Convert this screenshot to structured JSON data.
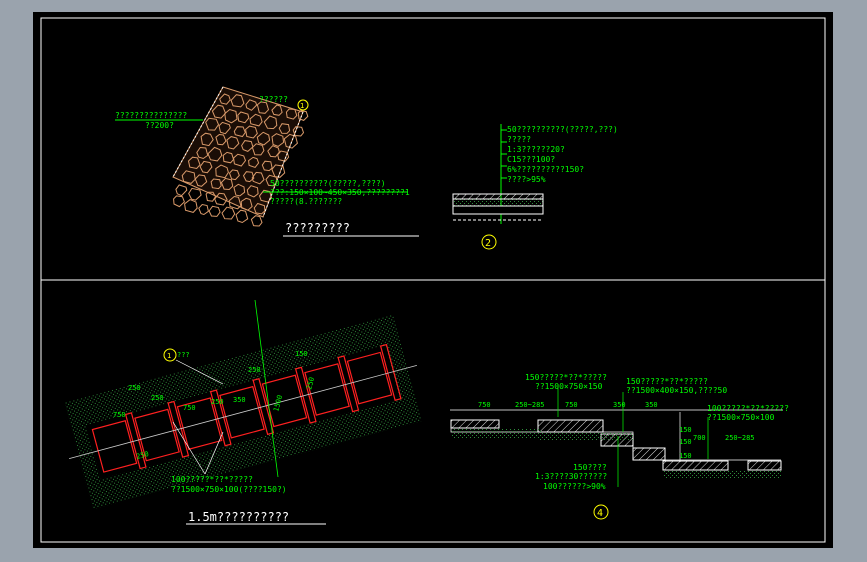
{
  "colors": {
    "background": "#000000",
    "frame": "#ffffff",
    "annotation": "#00ff00",
    "hatch_green": "#2e8b3a",
    "stone": "#d99a6a",
    "yellow": "#ffff00",
    "red": "#ff2020",
    "magenta": "#ff40ff",
    "gray_line": "#cccccc"
  },
  "panel1": {
    "note_left_1": "???????????????",
    "note_left_2": "??200?",
    "note_right": "??????",
    "marker": "1",
    "note_bottom_1": "50??????????(?????,????)",
    "note_bottom_2": "???:150×100~450×350,????????1",
    "note_bottom_3": "?????(8.???????",
    "title": "?????????"
  },
  "panel2": {
    "notes": [
      "50??????????(?????,???)",
      "?????",
      "1:3??????20?",
      "C15???100?",
      "6%??????????150?",
      "????>95%"
    ],
    "marker": "2"
  },
  "panel3": {
    "marker": "1",
    "marker_note": "???",
    "dims": [
      "250",
      "750",
      "250",
      "750",
      "250",
      "350",
      "250",
      "1500",
      "150",
      "250",
      "250"
    ],
    "note_bottom_1": "100?????*??*?????",
    "note_bottom_2": "??1500×750×100(????150?)",
    "title": "1.5m??????????"
  },
  "panel4": {
    "note_top_1": "150?????*??*?????",
    "note_top_2": "??1500×750×150",
    "note_mid_1": "150?????*??*?????",
    "note_mid_2": "??1500×400×150,????50",
    "note_right_1": "100?????*??*?????",
    "note_right_2": "??1500×750×100",
    "dims_top": [
      "750",
      "250~285",
      "750",
      "350",
      "350"
    ],
    "dims_side": [
      "150",
      "150",
      "150"
    ],
    "dims_low": [
      "700",
      "250~285"
    ],
    "note_low_1": "150????",
    "note_low_2": "1:3????30??????",
    "note_low_3": "100??????>90%",
    "marker": "4"
  }
}
